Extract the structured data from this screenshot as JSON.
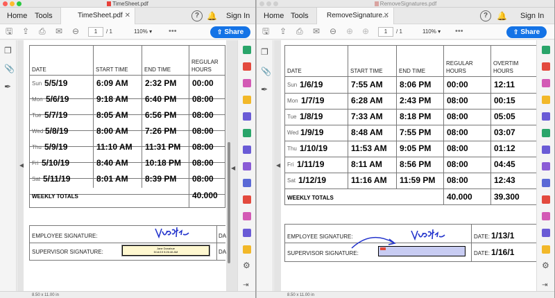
{
  "left": {
    "window_title": "TimeSheet.pdf",
    "nav": {
      "home": "Home",
      "tools": "Tools"
    },
    "tab_title": "TimeSheet.pdf",
    "sign_in": "Sign In",
    "page_current": "1",
    "page_total": "/ 1",
    "zoom": "110%",
    "share": "Share",
    "page_size": "8.50 x 11.00 in",
    "headers": {
      "date": "DATE",
      "start": "START TIME",
      "end": "END TIME",
      "regular_1": "REGULAR",
      "regular_2": "HOURS"
    },
    "rows": [
      {
        "day": "Sun",
        "date": "5/5/19",
        "start": "6:09 AM",
        "end": "2:32 PM",
        "regular": "00:00"
      },
      {
        "day": "Mon",
        "date": "5/6/19",
        "start": "9:18 AM",
        "end": "6:40 PM",
        "regular": "08:00"
      },
      {
        "day": "Tue",
        "date": "5/7/19",
        "start": "8:05 AM",
        "end": "6:56 PM",
        "regular": "08:00"
      },
      {
        "day": "Wed",
        "date": "5/8/19",
        "start": "8:00 AM",
        "end": "7:26 PM",
        "regular": "08:00"
      },
      {
        "day": "Thu",
        "date": "5/9/19",
        "start": "11:10 AM",
        "end": "11:31 PM",
        "regular": "08:00"
      },
      {
        "day": "Fri",
        "date": "5/10/19",
        "start": "8:40 AM",
        "end": "10:18 PM",
        "regular": "08:00"
      },
      {
        "day": "Sat",
        "date": "5/11/19",
        "start": "8:01 AM",
        "end": "8:39 PM",
        "regular": "08:00"
      }
    ],
    "weekly_totals_label": "WEEKLY TOTALS",
    "weekly_total": "40.000",
    "employee_sig_label": "EMPLOYEE SIGNATURE:",
    "supervisor_sig_label": "SUPERVISOR SIGNATURE:",
    "date_cut_1": "DA",
    "date_cut_2": "DA",
    "stamp_name": "Jane Donahue",
    "stamp_date": "5/14/19 5:26:46 AM"
  },
  "right": {
    "window_title": "RemoveSignatures.pdf",
    "nav": {
      "home": "Home",
      "tools": "Tools"
    },
    "tab_title": "RemoveSignature...",
    "sign_in": "Sign In",
    "page_current": "1",
    "page_total": "/ 1",
    "zoom": "110%",
    "share": "Share",
    "page_size": "8.50 x 11.00 in",
    "headers": {
      "date": "DATE",
      "start": "START TIME",
      "end": "END TIME",
      "regular_1": "REGULAR",
      "regular_2": "HOURS",
      "overtime_1": "OVERTIM",
      "overtime_2": "HOURS"
    },
    "rows": [
      {
        "day": "Sun",
        "date": "1/6/19",
        "start": "7:55 AM",
        "end": "8:06 PM",
        "regular": "00:00",
        "overtime": "12:11"
      },
      {
        "day": "Mon",
        "date": "1/7/19",
        "start": "6:28 AM",
        "end": "2:43 PM",
        "regular": "08:00",
        "overtime": "00:15"
      },
      {
        "day": "Tue",
        "date": "1/8/19",
        "start": "7:33 AM",
        "end": "8:18 PM",
        "regular": "08:00",
        "overtime": "05:05"
      },
      {
        "day": "Wed",
        "date": "1/9/19",
        "start": "8:48 AM",
        "end": "7:55 PM",
        "regular": "08:00",
        "overtime": "03:07"
      },
      {
        "day": "Thu",
        "date": "1/10/19",
        "start": "11:53 AM",
        "end": "9:05 PM",
        "regular": "08:00",
        "overtime": "01:12"
      },
      {
        "day": "Fri",
        "date": "1/11/19",
        "start": "8:11 AM",
        "end": "8:56 PM",
        "regular": "08:00",
        "overtime": "04:45"
      },
      {
        "day": "Sat",
        "date": "1/12/19",
        "start": "11:16 AM",
        "end": "11:59 PM",
        "regular": "08:00",
        "overtime": "12:43"
      }
    ],
    "weekly_totals_label": "WEEKLY TOTALS",
    "weekly_total": "40.000",
    "weekly_overtime": "39.300",
    "employee_sig_label": "EMPLOYEE SIGNATURE:",
    "supervisor_sig_label": "SUPERVISOR SIGNATURE:",
    "date_label_1": "DATE:",
    "date_value_1": "1/13/1",
    "date_label_2": "DATE:",
    "date_value_2": "1/16/1"
  },
  "colors": {
    "accent": "#1473e6",
    "stamp_fill": "#fff8d0",
    "sig_field_fill": "#c8ccf2",
    "signature_ink": "#2233cc"
  },
  "icons": [
    "save-icon",
    "upload-icon",
    "print-icon",
    "mail-icon",
    "zoom-out-icon",
    "page-up-icon",
    "page-down-icon",
    "more-icon",
    "help-icon",
    "bell-icon",
    "share-icon",
    "pages-panel-icon",
    "attachments-icon",
    "signature-panel-icon"
  ]
}
